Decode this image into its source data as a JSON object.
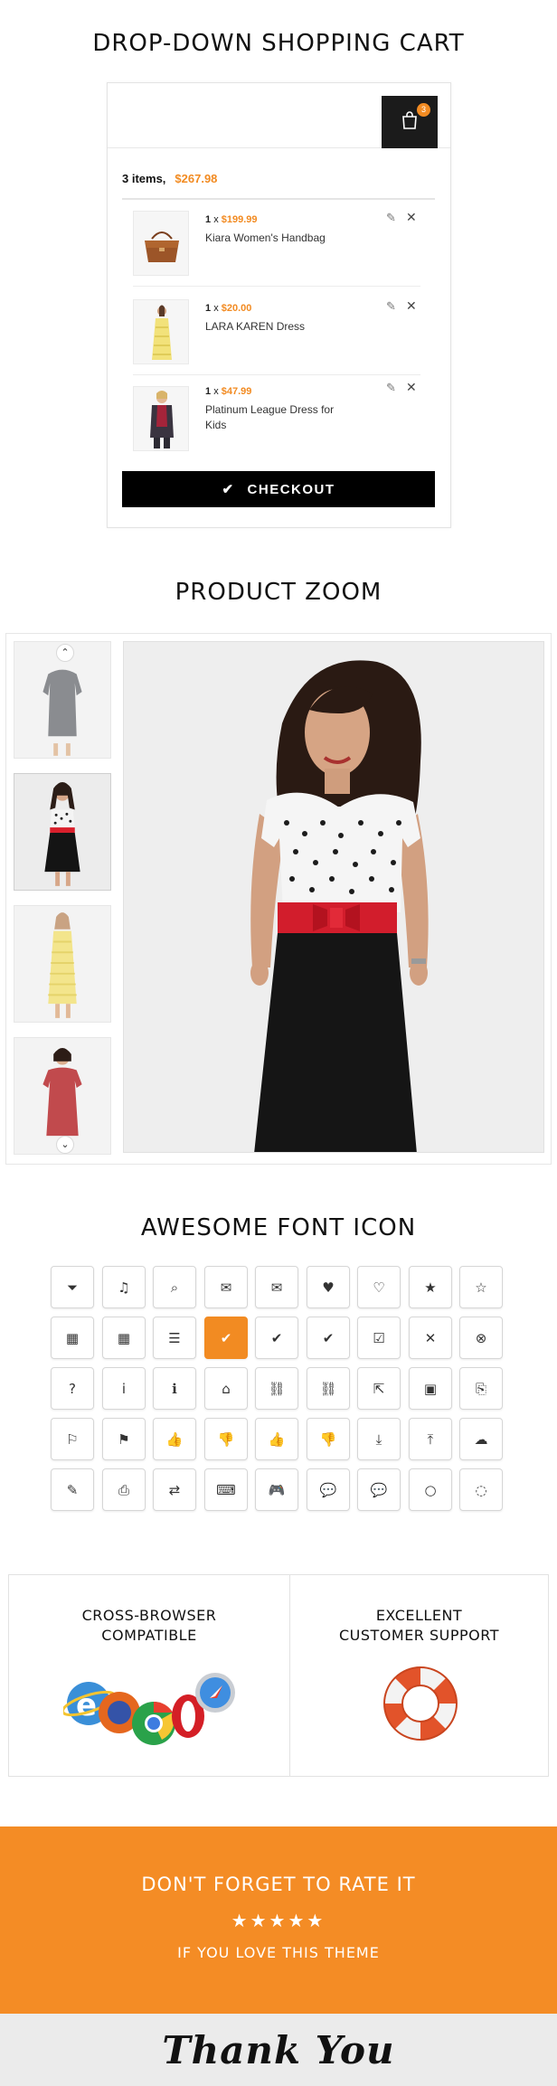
{
  "sections": {
    "cart_title": "DROP-DOWN SHOPPING CART",
    "zoom_title": "PRODUCT ZOOM",
    "icons_title": "AWESOME FONT ICON"
  },
  "cart": {
    "badge_count": "3",
    "summary_items": "3 items,",
    "summary_total": "$267.98",
    "checkout_label": "CHECKOUT",
    "items": [
      {
        "qty": "1",
        "x": "x",
        "price": "$199.99",
        "name": "Kiara Women's Handbag"
      },
      {
        "qty": "1",
        "x": "x",
        "price": "$20.00",
        "name": "LARA KAREN Dress"
      },
      {
        "qty": "1",
        "x": "x",
        "price": "$47.99",
        "name": "Platinum League Dress for Kids"
      }
    ]
  },
  "zoom": {
    "thumbnails": [
      "grey-dress",
      "polka-dot-dress",
      "yellow-dress",
      "red-dress"
    ],
    "active_index": 1,
    "up_arrow": "⌃",
    "down_arrow": "⌄"
  },
  "icons": {
    "rows": [
      [
        "filter-icon",
        "music-icon",
        "search-icon",
        "envelope-o-icon",
        "envelope-icon",
        "heart-icon",
        "heart-o-icon",
        "star-icon",
        "star-o-icon"
      ],
      [
        "th-large-icon",
        "th-icon",
        "th-list-icon",
        "check-icon",
        "check-circle-icon",
        "check-circle-o-icon",
        "check-square-icon",
        "times-icon",
        "times-circle-icon"
      ],
      [
        "question-circle-icon",
        "info-circle-icon",
        "info-icon",
        "home-icon",
        "link-icon",
        "unlink-icon",
        "external-link-icon",
        "picture-icon",
        "paperclip-icon"
      ],
      [
        "flag-o-icon",
        "flag-checkered-icon",
        "thumbs-o-up-icon",
        "thumbs-o-down-icon",
        "thumbs-up-icon",
        "thumbs-down-icon",
        "download-icon",
        "upload-icon",
        "cloud-download-icon"
      ],
      [
        "edit-icon",
        "print-icon",
        "retweet-icon",
        "keyboard-icon",
        "gamepad-icon",
        "comment-icon",
        "comments-icon",
        "comment-o-icon",
        "comments-o-icon"
      ]
    ],
    "glyphs": [
      [
        "⏷",
        "♫",
        "⌕",
        "✉",
        "✉",
        "♥",
        "♡",
        "★",
        "☆"
      ],
      [
        "▦",
        "▦",
        "☰",
        "✔",
        "✔",
        "✔",
        "☑",
        "✕",
        "⊗"
      ],
      [
        "?",
        "i",
        "ℹ",
        "⌂",
        "⛓",
        "⛓",
        "⇱",
        "▣",
        "⎘"
      ],
      [
        "⚐",
        "⚑",
        "👍",
        "👎",
        "👍",
        "👎",
        "⤓",
        "⤒",
        "☁"
      ],
      [
        "✎",
        "⎙",
        "⇄",
        "⌨",
        "🎮",
        "💬",
        "💬",
        "○",
        "◌"
      ]
    ],
    "active_icon": "check-icon",
    "accent_color": "#f28b22"
  },
  "features": {
    "left_title_line1": "CROSS-BROWSER",
    "left_title_line2": "COMPATIBLE",
    "right_title_line1": "EXCELLENT",
    "right_title_line2": "CUSTOMER SUPPORT"
  },
  "rate": {
    "title": "DON'T FORGET TO RATE IT",
    "stars": "★★★★★",
    "subtitle": "IF YOU LOVE THIS THEME",
    "band_color": "#f48c25"
  },
  "thanks": {
    "text": "Thank You"
  }
}
